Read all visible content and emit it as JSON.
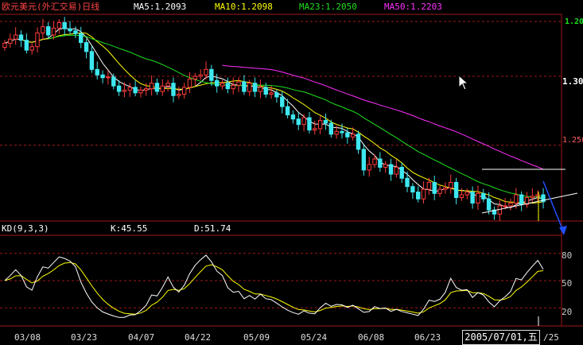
{
  "header": {
    "title": "欧元美元(外汇交易)日线",
    "ma5": "MA5:1.2093",
    "ma10": "MA10:1.2098",
    "ma23": "MA23:1.2050",
    "ma50": "MA50:1.2203"
  },
  "kd_header": {
    "name": "KD(9,3,3)",
    "k": "K:45.55",
    "d": "D:51.74"
  },
  "price_axis": {
    "labels": [
      "1.20",
      "1.30",
      "1.250"
    ]
  },
  "kd_axis": {
    "labels": [
      "80",
      "50",
      "20"
    ]
  },
  "date_axis": {
    "labels": [
      "03/08",
      "03/23",
      "04/07",
      "04/22",
      "05/09",
      "05/24",
      "06/08",
      "06/23",
      "/25"
    ]
  },
  "cursor": {
    "date_label": "2005/07/01,五"
  },
  "colors": {
    "up": "#ff3b3b",
    "down": "#3ee8f0",
    "ma5": "#ffffff",
    "ma10": "#ffff00",
    "ma23": "#1fe01f",
    "ma50": "#ff30ff",
    "grid": "#a01818",
    "k_line": "#ffffff",
    "d_line": "#ffff00"
  },
  "chart_data": [
    {
      "type": "candlestick",
      "title": "欧元美元(外汇交易)日线",
      "date_range": [
        "03/08",
        "07/01"
      ],
      "ylim": [
        1.195,
        1.345
      ],
      "series_close": [
        1.324,
        1.327,
        1.33,
        1.3262,
        1.319,
        1.3215,
        1.3315,
        1.336,
        1.33,
        1.335,
        1.339,
        1.3345,
        1.333,
        1.331,
        1.3245,
        1.318,
        1.305,
        1.301,
        1.299,
        1.2995,
        1.293,
        1.289,
        1.29,
        1.292,
        1.288,
        1.29,
        1.291,
        1.295,
        1.289,
        1.293,
        1.295,
        1.286,
        1.287,
        1.292,
        1.298,
        1.3,
        1.301,
        1.305,
        1.297,
        1.293,
        1.295,
        1.291,
        1.2935,
        1.296,
        1.289,
        1.295,
        1.289,
        1.292,
        1.287,
        1.288,
        1.285,
        1.278,
        1.272,
        1.269,
        1.265,
        1.27,
        1.261,
        1.262,
        1.268,
        1.266,
        1.258,
        1.26,
        1.259,
        1.256,
        1.258,
        1.247,
        1.232,
        1.236,
        1.24,
        1.234,
        1.236,
        1.229,
        1.234,
        1.226,
        1.22,
        1.216,
        1.211,
        1.218,
        1.223,
        1.215,
        1.218,
        1.219,
        1.223,
        1.212,
        1.214,
        1.216,
        1.208,
        1.215,
        1.211,
        1.203,
        1.2,
        1.206,
        1.206,
        1.208,
        1.214,
        1.207,
        1.212,
        1.213,
        1.214,
        1.209
      ],
      "ma5_last": 1.2093,
      "ma10_last": 1.2098,
      "ma23_last": 1.205,
      "ma50_last": 1.2203
    },
    {
      "type": "line",
      "title": "KD(9,3,3)",
      "ylim": [
        0,
        100
      ],
      "gridlines": [
        80,
        50,
        20
      ],
      "series": [
        {
          "name": "K",
          "last": 45.55
        },
        {
          "name": "D",
          "last": 51.74
        }
      ]
    }
  ]
}
